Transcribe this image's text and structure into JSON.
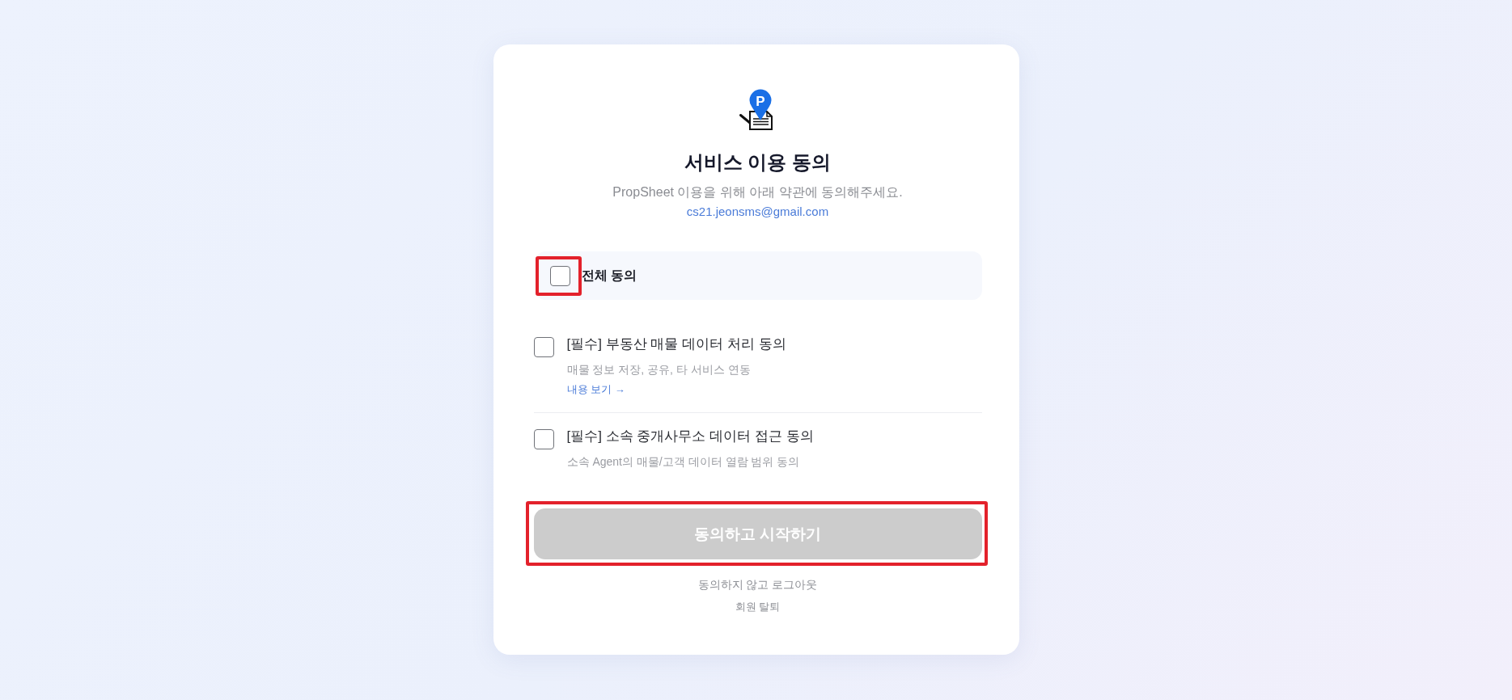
{
  "logo": {
    "letter": "P"
  },
  "header": {
    "title": "서비스 이용 동의",
    "subtitle": "PropSheet 이용을 위해 아래 약관에 동의해주세요.",
    "email": "cs21.jeonsms@gmail.com"
  },
  "all_agree": {
    "label": "전체 동의",
    "checked": false,
    "highlighted": true
  },
  "agreements": [
    {
      "title": "[필수] 부동산 매물 데이터 처리 동의",
      "description": "매물 정보 저장, 공유, 타 서비스 연동",
      "link": "내용 보기 →",
      "checked": false
    },
    {
      "title": "[필수] 소속 중개사무소 데이터 접근 동의",
      "description": "소속 Agent의 매물/고객 데이터 열람 범위 동의",
      "checked": false
    }
  ],
  "start_button": {
    "label": "동의하고 시작하기",
    "disabled": true,
    "highlighted": true
  },
  "logout_link": "동의하지 않고 로그아웃",
  "withdraw_link": "회원 탈퇴"
}
